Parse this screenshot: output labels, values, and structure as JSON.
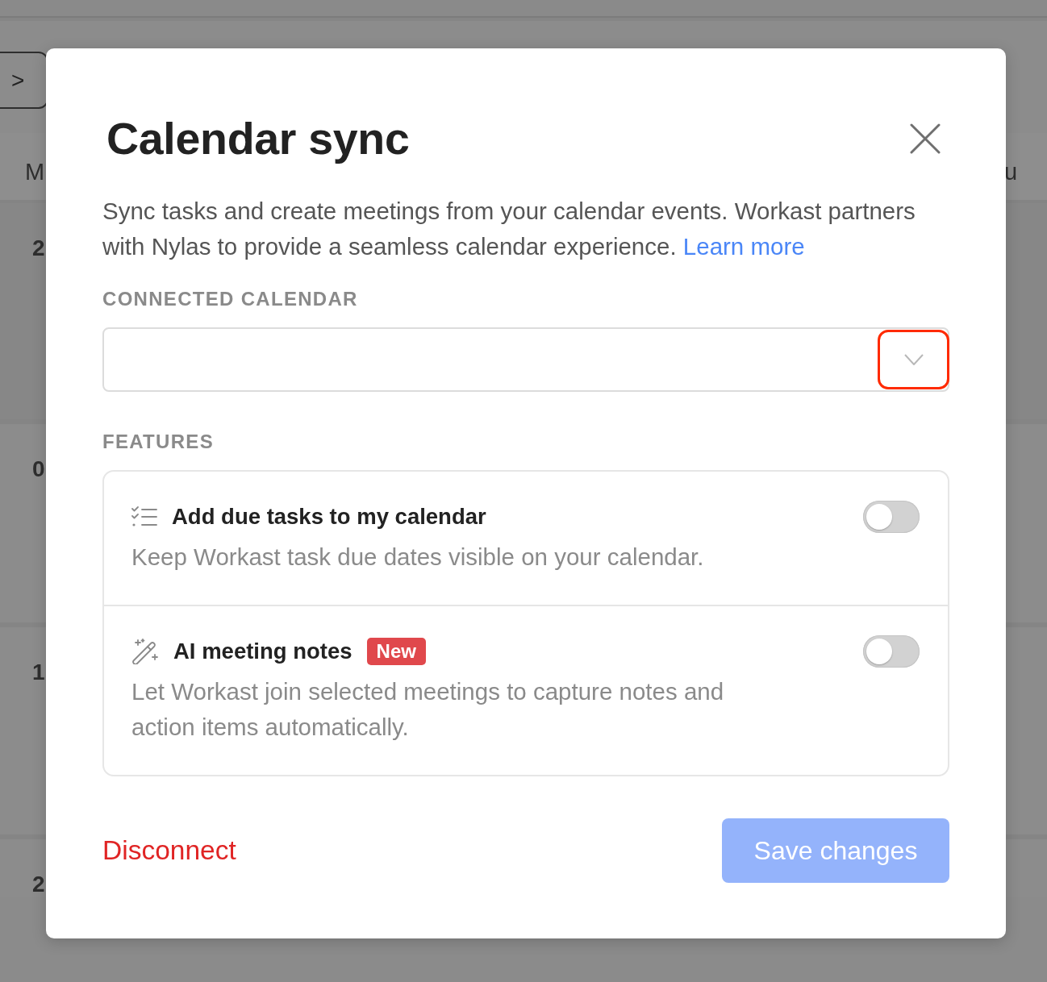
{
  "background": {
    "nav_button": ">",
    "weekday_labels": [
      "M",
      "u"
    ],
    "day_numbers": [
      "2",
      "0",
      "1",
      "2"
    ]
  },
  "dialog": {
    "title": "Calendar sync",
    "description": {
      "text": "Sync tasks and create meetings from your calendar events. Workast partners with Nylas to provide a seamless calendar experience.",
      "link": "Learn more"
    },
    "connected_calendar": {
      "label": "CONNECTED CALENDAR",
      "dropdown": {
        "highlighted": true
      }
    },
    "features": {
      "label": "FEATURES",
      "items": [
        {
          "kind": "tasks",
          "title": "Add due tasks to my calendar",
          "description": "Keep Workast task due dates visible on your calendar.",
          "on": false
        },
        {
          "kind": "ai",
          "title": "AI meeting notes",
          "badge": "New",
          "description": "Let Workast join selected meetings to capture notes and action items automatically.",
          "on": false
        }
      ]
    },
    "footer": {
      "disconnect": "Disconnect",
      "save_button": {
        "label": "Save changes",
        "disabled": true
      }
    }
  }
}
